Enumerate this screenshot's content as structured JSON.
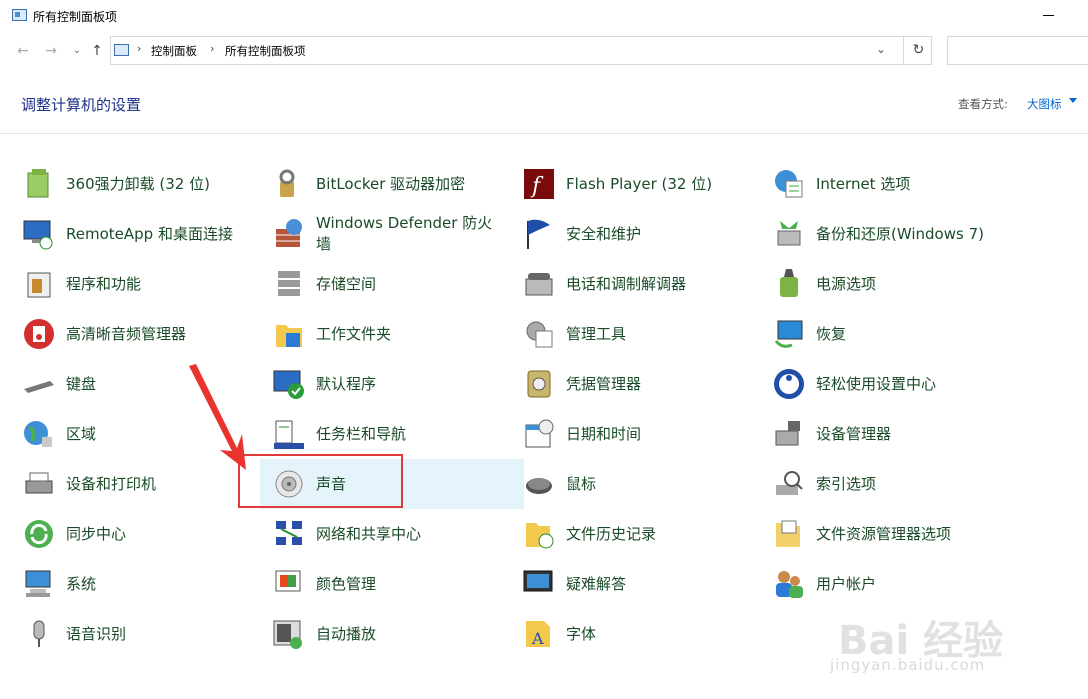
{
  "window": {
    "title": "所有控制面板项"
  },
  "address": {
    "crumbs": [
      "控制面板",
      "所有控制面板项"
    ],
    "search_placeholder": ""
  },
  "header": {
    "title": "调整计算机的设置",
    "view_by_label": "查看方式:",
    "view_by_value": "大图标"
  },
  "colors": {
    "link_green": "#1a4b28",
    "heading_blue": "#1e3287",
    "accent_blue": "#0066cc",
    "highlight_red": "#e03a3a",
    "selected_bg": "#e5f3fb"
  },
  "items": [
    {
      "label": "360强力卸载 (32 位)",
      "icon": "uninstall-icon"
    },
    {
      "label": "BitLocker 驱动器加密",
      "icon": "bitlocker-icon"
    },
    {
      "label": "Flash Player (32 位)",
      "icon": "flash-icon"
    },
    {
      "label": "Internet 选项",
      "icon": "internet-options-icon"
    },
    {
      "label": "RemoteApp 和桌面连接",
      "icon": "remoteapp-icon"
    },
    {
      "label": "Windows Defender 防火墙",
      "icon": "firewall-icon"
    },
    {
      "label": "安全和维护",
      "icon": "flag-icon"
    },
    {
      "label": "备份和还原(Windows 7)",
      "icon": "backup-icon"
    },
    {
      "label": "程序和功能",
      "icon": "programs-icon"
    },
    {
      "label": "存储空间",
      "icon": "storage-icon"
    },
    {
      "label": "电话和调制解调器",
      "icon": "phone-icon"
    },
    {
      "label": "电源选项",
      "icon": "power-icon"
    },
    {
      "label": "高清晰音频管理器",
      "icon": "audio-manager-icon"
    },
    {
      "label": "工作文件夹",
      "icon": "work-folders-icon"
    },
    {
      "label": "管理工具",
      "icon": "admin-tools-icon"
    },
    {
      "label": "恢复",
      "icon": "recovery-icon"
    },
    {
      "label": "键盘",
      "icon": "keyboard-icon"
    },
    {
      "label": "默认程序",
      "icon": "default-programs-icon"
    },
    {
      "label": "凭据管理器",
      "icon": "credential-icon"
    },
    {
      "label": "轻松使用设置中心",
      "icon": "ease-of-access-icon"
    },
    {
      "label": "区域",
      "icon": "region-icon"
    },
    {
      "label": "任务栏和导航",
      "icon": "taskbar-icon"
    },
    {
      "label": "日期和时间",
      "icon": "calendar-icon"
    },
    {
      "label": "设备管理器",
      "icon": "device-manager-icon"
    },
    {
      "label": "设备和打印机",
      "icon": "printer-icon"
    },
    {
      "label": "声音",
      "icon": "speaker-icon"
    },
    {
      "label": "鼠标",
      "icon": "mouse-icon"
    },
    {
      "label": "索引选项",
      "icon": "indexing-icon"
    },
    {
      "label": "同步中心",
      "icon": "sync-icon"
    },
    {
      "label": "网络和共享中心",
      "icon": "network-icon"
    },
    {
      "label": "文件历史记录",
      "icon": "file-history-icon"
    },
    {
      "label": "文件资源管理器选项",
      "icon": "folder-options-icon"
    },
    {
      "label": "系统",
      "icon": "system-icon"
    },
    {
      "label": "颜色管理",
      "icon": "color-management-icon"
    },
    {
      "label": "疑难解答",
      "icon": "troubleshoot-icon"
    },
    {
      "label": "用户帐户",
      "icon": "user-accounts-icon"
    },
    {
      "label": "语音识别",
      "icon": "microphone-icon"
    },
    {
      "label": "自动播放",
      "icon": "autoplay-icon"
    },
    {
      "label": "字体",
      "icon": "fonts-icon"
    }
  ],
  "watermark": {
    "main": "Bai 经验",
    "sub": "jingyan.baidu.com"
  }
}
